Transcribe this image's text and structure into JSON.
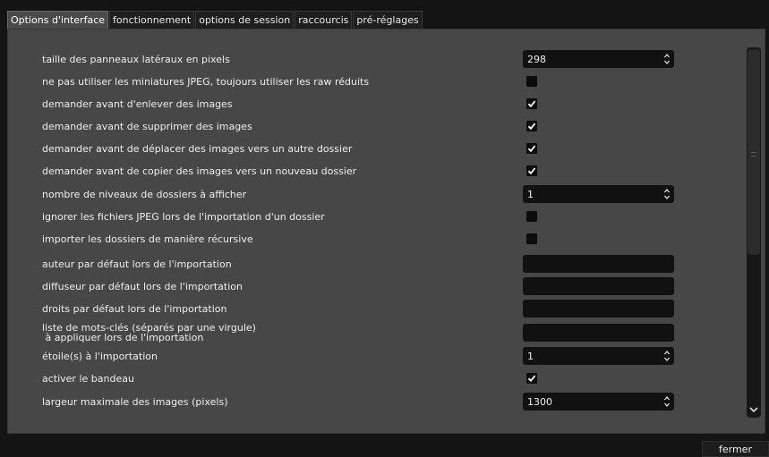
{
  "tabs": [
    {
      "label": "Options d'interface",
      "active": true
    },
    {
      "label": "fonctionnement",
      "active": false
    },
    {
      "label": "options de session",
      "active": false
    },
    {
      "label": "raccourcis",
      "active": false
    },
    {
      "label": "pré-réglages",
      "active": false
    }
  ],
  "settings": [
    {
      "label": "taille des panneaux latéraux en pixels",
      "control": "spin",
      "value": "298"
    },
    {
      "label": "ne pas utiliser les miniatures JPEG, toujours utiliser les raw réduits",
      "control": "checkbox",
      "checked": false
    },
    {
      "label": "demander avant d'enlever des images",
      "control": "checkbox",
      "checked": true
    },
    {
      "label": "demander avant de supprimer des images",
      "control": "checkbox",
      "checked": true
    },
    {
      "label": "demander avant de déplacer des images vers un autre dossier",
      "control": "checkbox",
      "checked": true
    },
    {
      "label": "demander avant de copier des images vers un nouveau dossier",
      "control": "checkbox",
      "checked": true
    },
    {
      "label": "nombre de niveaux de dossiers à afficher",
      "control": "spin",
      "value": "1"
    },
    {
      "label": "ignorer les fichiers JPEG lors de l'importation d'un dossier",
      "control": "checkbox",
      "checked": false
    },
    {
      "label": "importer les dossiers de manière récursive",
      "control": "checkbox",
      "checked": false
    },
    {
      "label": "auteur par défaut lors de l'importation",
      "control": "entry",
      "value": ""
    },
    {
      "label": "diffuseur par défaut lors de l'importation",
      "control": "entry",
      "value": ""
    },
    {
      "label": "droits par défaut lors de l'importation",
      "control": "entry",
      "value": ""
    },
    {
      "label": "liste de mots-clés (séparés par une virgule)",
      "label2": " à appliquer lors de l'importation",
      "control": "entry",
      "value": ""
    },
    {
      "label": "étoile(s) à l'importation",
      "control": "spin",
      "value": "1"
    },
    {
      "label": "activer le bandeau",
      "control": "checkbox",
      "checked": true
    },
    {
      "label": "largeur maximale des images (pixels)",
      "control": "spin",
      "value": "1300"
    }
  ],
  "footer": {
    "close_label": "fermer"
  },
  "icons": {
    "spin_arrows": "updown-chevron-icon",
    "check": "checkmark-icon",
    "scroll_down": "chevron-down-icon"
  },
  "colors": {
    "panel": "#474747",
    "field": "#111111",
    "background": "#141414"
  }
}
